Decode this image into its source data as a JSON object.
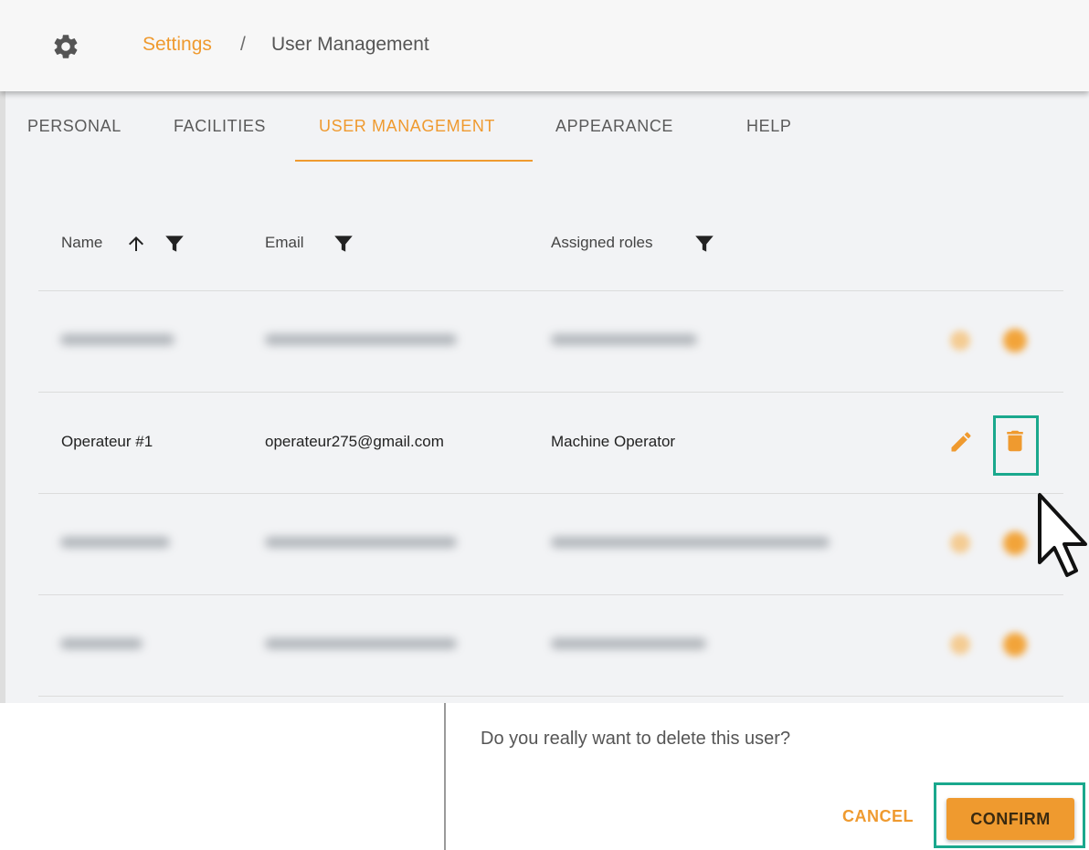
{
  "colors": {
    "accent": "#ef9a2f",
    "highlight": "#1aa88d",
    "background": "#f2f3f5"
  },
  "header": {
    "icon": "gear-icon",
    "breadcrumb_parent": "Settings",
    "breadcrumb_separator": "/",
    "breadcrumb_current": "User Management"
  },
  "tabs": [
    {
      "label": "PERSONAL"
    },
    {
      "label": "FACILITIES"
    },
    {
      "label": "USER MANAGEMENT",
      "active": true
    },
    {
      "label": "APPEARANCE"
    },
    {
      "label": "HELP"
    }
  ],
  "table": {
    "columns": [
      {
        "label": "Name",
        "icons": [
          "sort-ascending-icon",
          "filter-icon"
        ]
      },
      {
        "label": "Email",
        "icons": [
          "filter-icon"
        ]
      },
      {
        "label": "Assigned roles",
        "icons": [
          "filter-icon"
        ]
      }
    ],
    "visible_row": {
      "name": "Operateur #1",
      "email": "operateur275@gmail.com",
      "role": "Machine Operator",
      "actions": [
        "edit-icon",
        "delete-icon"
      ]
    }
  },
  "dialog": {
    "message": "Do you really want to delete this user?",
    "cancel_label": "CANCEL",
    "confirm_label": "CONFIRM"
  }
}
